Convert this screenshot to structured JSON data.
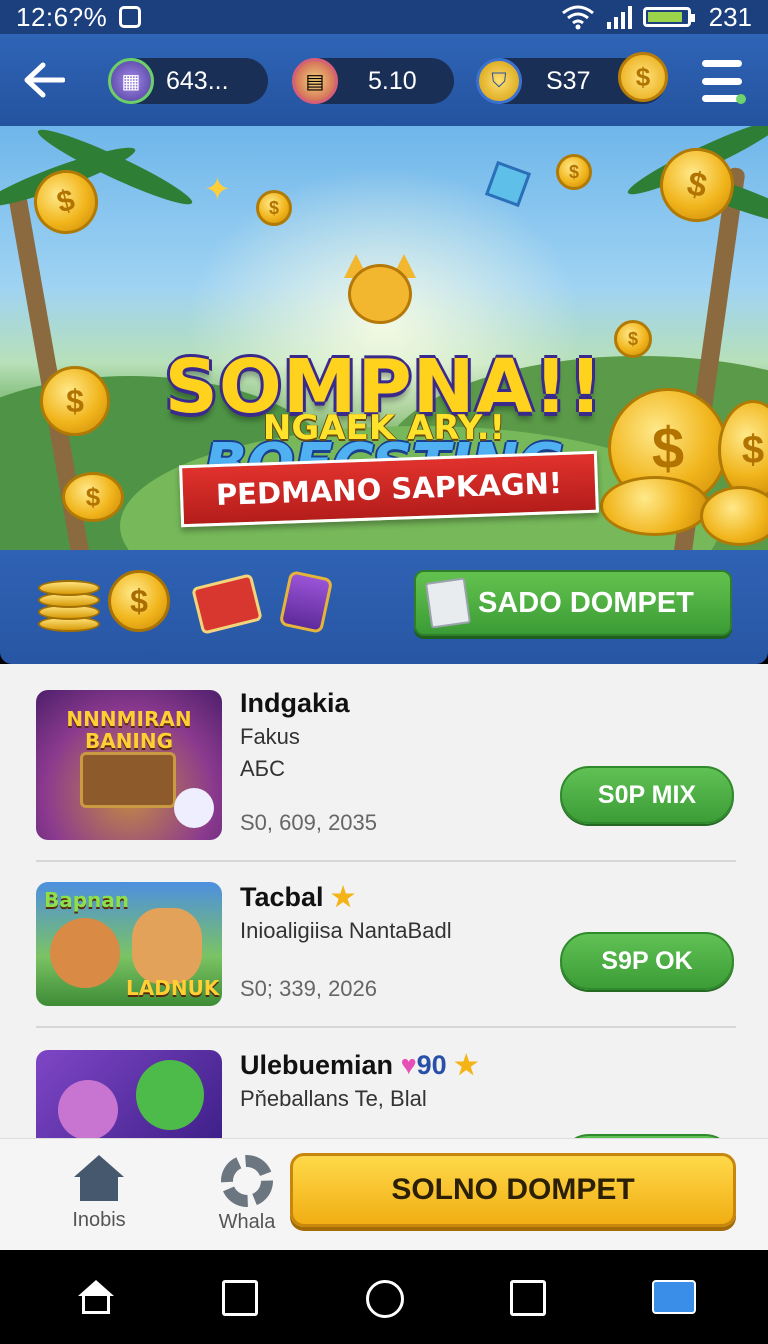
{
  "status_bar": {
    "time": "12:6?%",
    "battery": "231"
  },
  "header": {
    "back_icon": "arrow-left-icon",
    "currency": [
      {
        "value": "643...",
        "icon": "gem-book-icon"
      },
      {
        "value": "5.10",
        "icon": "ticket-icon"
      },
      {
        "value": "S37",
        "icon": "shield-coin-icon"
      }
    ],
    "menu_icon": "menu-icon"
  },
  "banner": {
    "title_line1": "SOMPNA!!",
    "title_line2": "BOECSTING",
    "tagline": "NGAEK ARY.!",
    "ribbon": "PEDMANO SAPKAGN!"
  },
  "reward_strip": {
    "button_label": "SADO DOMPET"
  },
  "list": [
    {
      "title": "Indgakia",
      "subtitle": "Fakus",
      "subtitle2": "AБC",
      "date": "S0, 609, 2035",
      "button": "S0P MIX",
      "thumb_text": "NNNMIRAN BANING"
    },
    {
      "title": "Tacbal",
      "subtitle": "Inioaligiisa NantaBadl",
      "date": "S0; 339, 2026",
      "button": "S9P OK",
      "thumb_text": "LADNUK",
      "thumb_text_top": "Bapnan"
    },
    {
      "title": "Ulebuemian",
      "badge_num": "90",
      "subtitle": "Pňeballans Te, Blal"
    }
  ],
  "bottom_nav": {
    "home_label": "Inobis",
    "settings_label": "Whala",
    "cta_label": "SOLNO DOMPET"
  },
  "colors": {
    "header": "#2f64b6",
    "accent_green": "#4caf50",
    "accent_yellow": "#f5c02a"
  }
}
